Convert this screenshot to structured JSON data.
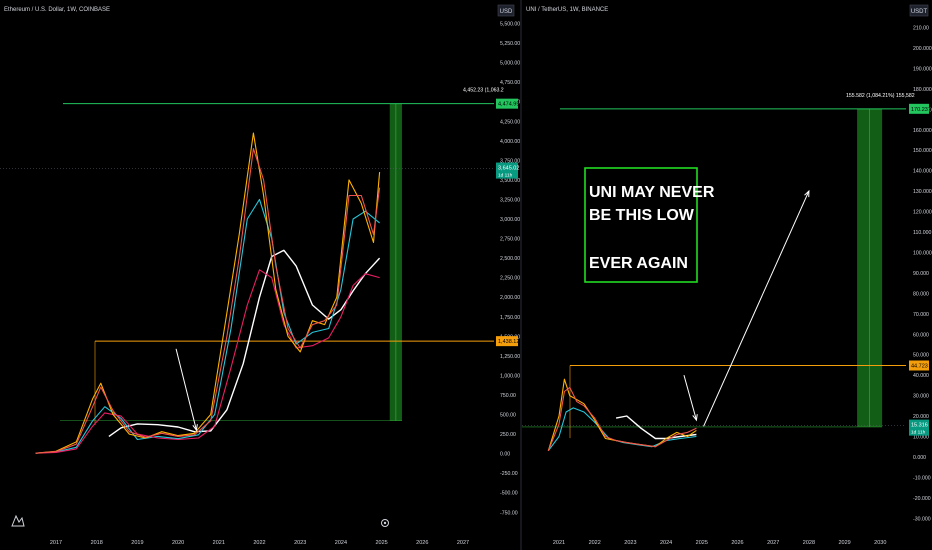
{
  "colors": {
    "background": "#000000",
    "text": "#d1d4dc",
    "green_line": "#22c55e",
    "orange_line": "#f59e0b",
    "green_zone": "#166f1a",
    "price_tag_teal": "#089981",
    "arrow": "#ffffff",
    "callout_border": "#22dd22"
  },
  "chart_data": [
    {
      "type": "line",
      "title": "Ethereum / U.S. Dollar, 1W, COINBASE",
      "currency": "USD",
      "y_ticks": [
        "5,500.00",
        "5,250.00",
        "5,000.00",
        "4,750.00",
        "4,500.00",
        "4,250.00",
        "4,000.00",
        "3,750.00",
        "3,500.00",
        "3,250.00",
        "3,000.00",
        "2,750.00",
        "2,500.00",
        "2,250.00",
        "2,000.00",
        "1,750.00",
        "1,500.00",
        "1,250.00",
        "1,000.00",
        "750.00",
        "500.00",
        "250.00",
        "0.00",
        "-250.00",
        "-500.00",
        "-750.00"
      ],
      "x_ticks": [
        "2017",
        "2018",
        "2019",
        "2020",
        "2021",
        "2022",
        "2023",
        "2024",
        "2025",
        "2026",
        "2027"
      ],
      "ylim": [
        -750,
        5500
      ],
      "price_labels": {
        "target": "4,474.95",
        "target_note": "4,452.23 (1,063.2",
        "current": "3,645.02",
        "current_sub": "1d 11h",
        "support": "1,438.12"
      },
      "target_level": 4474.95,
      "support_level": 1438.12,
      "current_price": 3645.02,
      "zone": {
        "from_year": 2025.2,
        "to_year": 2025.5,
        "low": 420,
        "high": 4474.95
      },
      "arrow": {
        "from": [
          2019.95,
          1340
        ],
        "to": [
          2020.45,
          300
        ]
      },
      "series": [
        {
          "color": "#ffffff",
          "x": [
            2018.3,
            2018.6,
            2019.0,
            2019.5,
            2020.0,
            2020.4,
            2020.8,
            2021.2,
            2021.6,
            2022.0,
            2022.3,
            2022.6,
            2022.9,
            2023.3,
            2023.7,
            2024.0,
            2024.3,
            2024.6,
            2024.95
          ],
          "values": [
            220,
            330,
            380,
            370,
            340,
            280,
            290,
            560,
            1150,
            2000,
            2520,
            2600,
            2400,
            1900,
            1720,
            1840,
            2080,
            2300,
            2500
          ]
        },
        {
          "color": "#26c6da",
          "x": [
            2016.5,
            2017.0,
            2017.5,
            2017.9,
            2018.2,
            2018.6,
            2019.0,
            2019.5,
            2020.0,
            2020.5,
            2020.9,
            2021.3,
            2021.7,
            2022.0,
            2022.3,
            2022.6,
            2022.9,
            2023.3,
            2023.7,
            2024.0,
            2024.3,
            2024.6,
            2024.95
          ],
          "values": [
            5,
            20,
            80,
            420,
            600,
            450,
            180,
            220,
            190,
            240,
            500,
            1600,
            3000,
            3250,
            2750,
            1800,
            1400,
            1550,
            1600,
            2100,
            3000,
            3100,
            2950
          ]
        },
        {
          "color": "#e91e63",
          "x": [
            2016.5,
            2017.0,
            2017.5,
            2017.9,
            2018.2,
            2018.6,
            2019.0,
            2019.5,
            2020.0,
            2020.5,
            2020.9,
            2021.3,
            2021.7,
            2022.0,
            2022.3,
            2022.6,
            2022.9,
            2023.3,
            2023.7,
            2024.0,
            2024.3,
            2024.6,
            2024.95
          ],
          "values": [
            5,
            15,
            60,
            350,
            520,
            480,
            250,
            200,
            180,
            200,
            350,
            1100,
            1900,
            2350,
            2250,
            1650,
            1350,
            1380,
            1480,
            1750,
            2150,
            2300,
            2250
          ]
        },
        {
          "color": "#ffb300",
          "x": [
            2016.5,
            2017.0,
            2017.5,
            2017.9,
            2018.1,
            2018.4,
            2018.8,
            2019.2,
            2019.6,
            2020.0,
            2020.4,
            2020.8,
            2021.2,
            2021.5,
            2021.85,
            2022.1,
            2022.4,
            2022.7,
            2023.0,
            2023.3,
            2023.6,
            2023.9,
            2024.2,
            2024.5,
            2024.8,
            2024.95
          ],
          "values": [
            5,
            30,
            150,
            700,
            900,
            500,
            250,
            200,
            280,
            230,
            260,
            500,
            1800,
            2800,
            4100,
            3300,
            2100,
            1500,
            1300,
            1700,
            1650,
            2000,
            3500,
            3200,
            2700,
            3600
          ]
        },
        {
          "color": "#ef5350",
          "x": [
            2016.5,
            2017.0,
            2017.5,
            2017.9,
            2018.1,
            2018.4,
            2018.8,
            2019.2,
            2019.6,
            2020.0,
            2020.4,
            2020.8,
            2021.2,
            2021.5,
            2021.85,
            2022.1,
            2022.4,
            2022.7,
            2023.0,
            2023.3,
            2023.6,
            2023.9,
            2024.2,
            2024.5,
            2024.8,
            2024.95
          ],
          "values": [
            5,
            25,
            120,
            600,
            850,
            550,
            280,
            210,
            260,
            220,
            240,
            420,
            1500,
            2500,
            3900,
            3500,
            2400,
            1600,
            1350,
            1650,
            1700,
            1900,
            3300,
            3300,
            2800,
            3400
          ]
        }
      ]
    },
    {
      "type": "line",
      "title": "UNI / TetherUS, 1W, BINANCE",
      "currency": "USDT",
      "y_ticks": [
        "210.00",
        "200.000",
        "190.000",
        "180.000",
        "170.000",
        "160.000",
        "150.000",
        "140.000",
        "130.000",
        "120.000",
        "110.000",
        "100.000",
        "90.000",
        "80.000",
        "70.000",
        "60.000",
        "50.000",
        "40.000",
        "30.000",
        "20.000",
        "10.000",
        "0.000",
        "-10.000",
        "-20.000",
        "-30.000"
      ],
      "x_ticks": [
        "2021",
        "2022",
        "2023",
        "2024",
        "2025",
        "2026",
        "2027",
        "2028",
        "2029",
        "2030"
      ],
      "ylim": [
        -35,
        210
      ],
      "price_labels": {
        "target": "170.237",
        "target_note": "155.582 (1,084.21%) 155,582",
        "current": "15.316",
        "current_sub": "1d 11h",
        "support": "44.723"
      },
      "target_level": 170.237,
      "support_level": 44.723,
      "current_price": 15.316,
      "zone": {
        "from_year": 2029.35,
        "to_year": 2030.05,
        "low": 14.7,
        "high": 170.237
      },
      "arrow": {
        "from": [
          2025.05,
          15
        ],
        "to": [
          2028.0,
          130
        ]
      },
      "arrow2": {
        "from": [
          2024.5,
          40
        ],
        "to": [
          2024.85,
          18
        ]
      },
      "callout_lines": [
        "UNI MAY NEVER",
        "BE THIS LOW",
        "",
        "EVER AGAIN"
      ],
      "series": [
        {
          "color": "#ffffff",
          "x": [
            2022.6,
            2022.9,
            2023.3,
            2023.7,
            2024.0,
            2024.4,
            2024.85
          ],
          "values": [
            19,
            20,
            14,
            9,
            9,
            10,
            11
          ]
        },
        {
          "color": "#26c6da",
          "x": [
            2020.7,
            2021.0,
            2021.2,
            2021.4,
            2021.7,
            2022.0,
            2022.4,
            2022.8,
            2023.2,
            2023.6,
            2024.0,
            2024.4,
            2024.85
          ],
          "values": [
            3,
            10,
            22,
            24,
            22,
            17,
            9,
            7,
            6,
            5,
            8,
            9,
            10
          ]
        },
        {
          "color": "#ffb300",
          "x": [
            2020.7,
            2021.0,
            2021.15,
            2021.3,
            2021.5,
            2021.7,
            2022.0,
            2022.3,
            2022.6,
            2022.9,
            2023.3,
            2023.7,
            2024.0,
            2024.3,
            2024.6,
            2024.85
          ],
          "values": [
            3,
            20,
            38,
            30,
            28,
            26,
            18,
            9,
            8,
            7,
            6,
            5,
            9,
            12,
            10,
            13
          ]
        },
        {
          "color": "#ef5350",
          "x": [
            2020.7,
            2021.0,
            2021.15,
            2021.3,
            2021.5,
            2021.7,
            2022.0,
            2022.3,
            2022.6,
            2022.9,
            2023.3,
            2023.7,
            2024.0,
            2024.3,
            2024.6,
            2024.85
          ],
          "values": [
            3,
            16,
            32,
            34,
            27,
            25,
            19,
            10,
            8,
            7,
            6,
            5,
            8,
            11,
            12,
            14
          ]
        }
      ]
    }
  ]
}
